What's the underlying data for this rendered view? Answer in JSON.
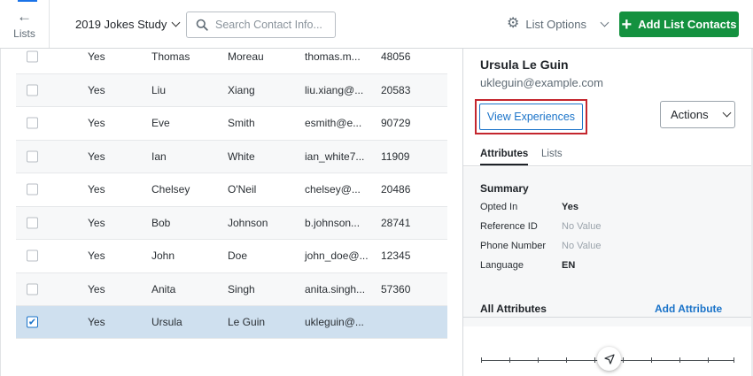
{
  "header": {
    "back_label": "Lists",
    "study_name": "2019 Jokes Study",
    "search_placeholder": "Search Contact Info...",
    "list_options_label": "List Options",
    "add_contacts_label": "Add List Contacts",
    "accent_color": "#14913f"
  },
  "table": {
    "rows": [
      {
        "opted": "Yes",
        "first": "Thomas",
        "last": "Moreau",
        "email": "thomas.m...",
        "zip": "48056",
        "checked": false
      },
      {
        "opted": "Yes",
        "first": "Liu",
        "last": "Xiang",
        "email": "liu.xiang@...",
        "zip": "20583",
        "checked": false
      },
      {
        "opted": "Yes",
        "first": "Eve",
        "last": "Smith",
        "email": "esmith@e...",
        "zip": "90729",
        "checked": false
      },
      {
        "opted": "Yes",
        "first": "Ian",
        "last": "White",
        "email": "ian_white7...",
        "zip": "11909",
        "checked": false
      },
      {
        "opted": "Yes",
        "first": "Chelsey",
        "last": "O'Neil",
        "email": "chelsey@...",
        "zip": "20486",
        "checked": false
      },
      {
        "opted": "Yes",
        "first": "Bob",
        "last": "Johnson",
        "email": "b.johnson...",
        "zip": "28741",
        "checked": false
      },
      {
        "opted": "Yes",
        "first": "John",
        "last": "Doe",
        "email": "john_doe@...",
        "zip": "12345",
        "checked": false
      },
      {
        "opted": "Yes",
        "first": "Anita",
        "last": "Singh",
        "email": "anita.singh...",
        "zip": "57360",
        "checked": false
      },
      {
        "opted": "Yes",
        "first": "Ursula",
        "last": "Le Guin",
        "email": "ukleguin@...",
        "zip": "",
        "checked": true
      }
    ]
  },
  "panel": {
    "contact_name": "Ursula Le Guin",
    "contact_email": "ukleguin@example.com",
    "view_experiences_label": "View Experiences",
    "actions_label": "Actions",
    "tabs": [
      {
        "label": "Attributes",
        "active": true
      },
      {
        "label": "Lists",
        "active": false
      }
    ],
    "summary_title": "Summary",
    "summary": [
      {
        "label": "Opted In",
        "value": "Yes",
        "empty": false
      },
      {
        "label": "Reference ID",
        "value": "No Value",
        "empty": true
      },
      {
        "label": "Phone Number",
        "value": "No Value",
        "empty": true
      },
      {
        "label": "Language",
        "value": "EN",
        "empty": false
      }
    ],
    "all_attributes_title": "All Attributes",
    "add_attribute_label": "Add Attribute",
    "highlight_color": "#c4262e"
  },
  "icons": {
    "back": "arrow-left-icon",
    "search": "search-icon",
    "settings": "gear-icon",
    "add": "plus-icon",
    "dropdown": "chevron-down-icon",
    "checkbox_checked": "check-icon",
    "pin": "location-arrow-icon"
  }
}
